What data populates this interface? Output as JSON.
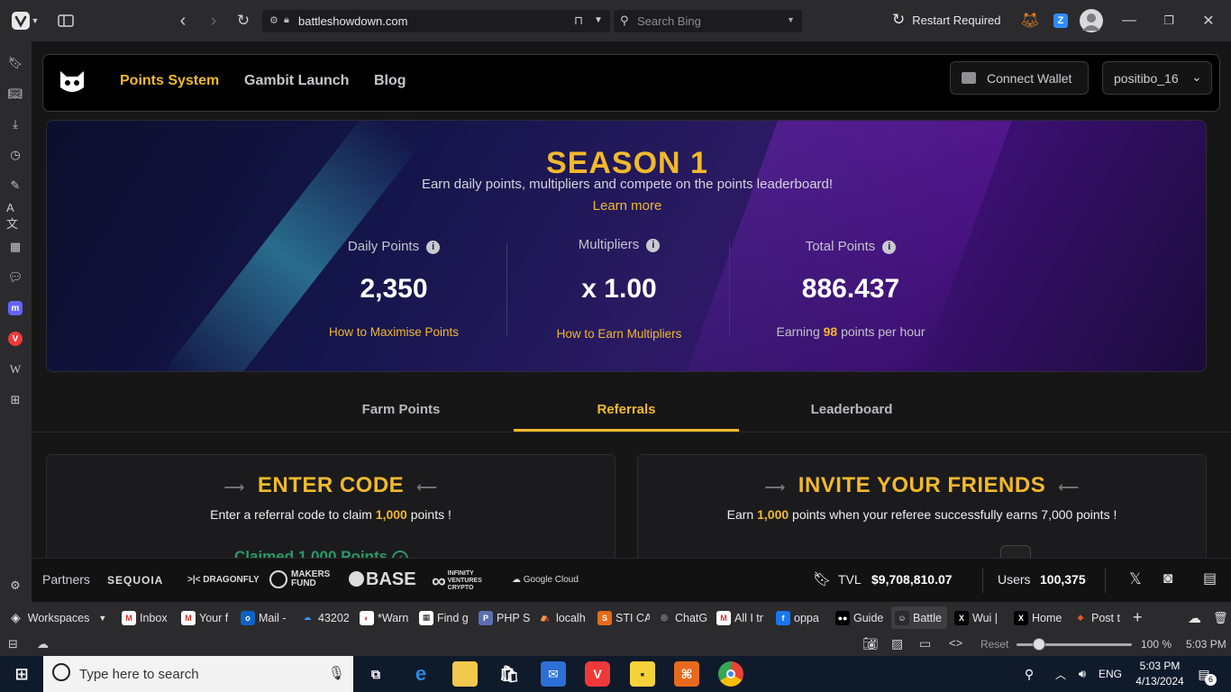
{
  "browser": {
    "url": "battleshowdown.com",
    "search_placeholder": "Search Bing",
    "restart_label": "Restart Required",
    "zoom": "100 %",
    "reset_label": "Reset",
    "status_time": "5:03 PM",
    "workspaces_label": "Workspaces",
    "tabs": [
      {
        "label": "Inbox",
        "color": "#ffffff",
        "glyph": "M",
        "glyph_color": "#d93025"
      },
      {
        "label": "Your f",
        "color": "#ffffff",
        "glyph": "M",
        "glyph_color": "#d93025"
      },
      {
        "label": "Mail -",
        "color": "#0a64c4",
        "glyph": "o",
        "glyph_color": "#ffffff"
      },
      {
        "label": "43202",
        "color": "#2b2b2e",
        "glyph": "☁",
        "glyph_color": "#3b8eea"
      },
      {
        "label": "*Warn",
        "color": "#ffffff",
        "glyph": "◐",
        "glyph_color": "#e03030"
      },
      {
        "label": "Find g",
        "color": "#ffffff",
        "glyph": "▦",
        "glyph_color": "#222222"
      },
      {
        "label": "PHP S",
        "color": "#5b6fb0",
        "glyph": "P",
        "glyph_color": "#ffffff"
      },
      {
        "label": "localh",
        "color": "#2b2b2e",
        "glyph": "⛺",
        "glyph_color": "#f0a030"
      },
      {
        "label": "STI CA",
        "color": "#e76a1d",
        "glyph": "S",
        "glyph_color": "#ffffff"
      },
      {
        "label": "ChatG",
        "color": "#2b2b2e",
        "glyph": "◎",
        "glyph_color": "#dddddd"
      },
      {
        "label": "All I tr",
        "color": "#ffffff",
        "glyph": "M",
        "glyph_color": "#d93025"
      },
      {
        "label": "oppa",
        "color": "#1877f2",
        "glyph": "f",
        "glyph_color": "#ffffff"
      },
      {
        "label": "Guide",
        "color": "#000000",
        "glyph": "●●",
        "glyph_color": "#ffffff"
      },
      {
        "label": "Battle",
        "color": "#2b2b2e",
        "glyph": "☺",
        "glyph_color": "#ffffff"
      },
      {
        "label": "Wui |",
        "color": "#000000",
        "glyph": "X",
        "glyph_color": "#ffffff"
      },
      {
        "label": "Home",
        "color": "#000000",
        "glyph": "X",
        "glyph_color": "#ffffff"
      },
      {
        "label": "Post t",
        "color": "#2b2b2e",
        "glyph": "◆",
        "glyph_color": "#e2572b"
      }
    ]
  },
  "nav": {
    "links": [
      "Points System",
      "Gambit Launch",
      "Blog"
    ],
    "connect_wallet": "Connect Wallet",
    "user": "positibo_16"
  },
  "hero": {
    "title": "SEASON 1",
    "subtitle": "Earn daily points, multipliers and compete on the points leaderboard!",
    "learn_more": "Learn more",
    "daily_label": "Daily Points",
    "daily_value": "2,350",
    "daily_link": "How to Maximise Points",
    "mult_label": "Multipliers",
    "mult_value": "x 1.00",
    "mult_link": "How to Earn Multipliers",
    "total_label": "Total Points",
    "total_value": "886.437",
    "earning_prefix": "Earning",
    "earning_rate": "98",
    "earning_suffix": "points per hour"
  },
  "tabs": [
    "Farm Points",
    "Referrals",
    "Leaderboard"
  ],
  "cards": {
    "enter_title": "ENTER CODE",
    "enter_sub_a": "Enter a referral code to claim",
    "enter_sub_b": "1,000",
    "enter_sub_c": "points !",
    "enter_claimed": "Claimed 1,000 Points",
    "invite_title": "INVITE YOUR FRIENDS",
    "invite_sub_a": "Earn",
    "invite_sub_b": "1,000",
    "invite_sub_c": "points when your referee successfully earns 7,000 points !"
  },
  "partners": {
    "label": "Partners",
    "names": [
      "SEQUOIA",
      "DRAGONFLY",
      "MAKERS FUND",
      "BASE",
      "INFINITY VENTURES CRYPTO",
      "Google Cloud"
    ],
    "tvl_label": "TVL",
    "tvl_value": "$9,708,810.07",
    "users_label": "Users",
    "users_value": "100,375"
  },
  "taskbar": {
    "search_placeholder": "Type here to search",
    "language": "ENG",
    "time": "5:03 PM",
    "date": "4/13/2024",
    "notif_count": "6"
  }
}
